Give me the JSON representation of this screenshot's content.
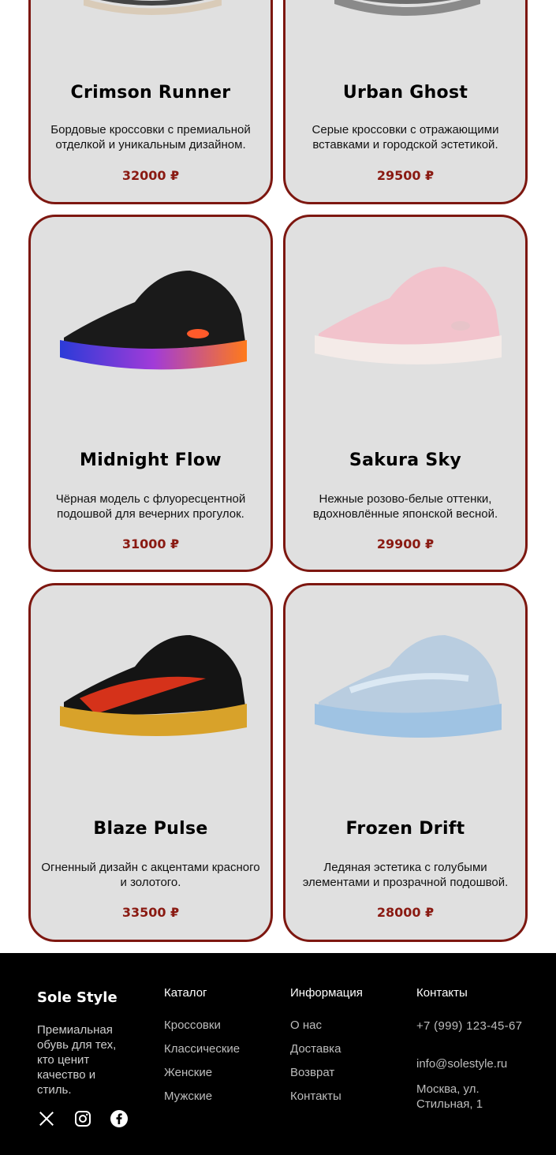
{
  "products": [
    {
      "name": "Crimson Runner",
      "desc": "Бордовые кроссовки с премиальной отделкой и уникальным дизайном.",
      "price": "32000 ₽"
    },
    {
      "name": "Urban Ghost",
      "desc": "Серые кроссовки с отражающими вставками и городской эстетикой.",
      "price": "29500 ₽"
    },
    {
      "name": "Midnight Flow",
      "desc": "Чёрная модель с флуоресцентной подошвой для вечерних прогулок.",
      "price": "31000 ₽"
    },
    {
      "name": "Sakura Sky",
      "desc": "Нежные розово-белые оттенки, вдохновлённые японской весной.",
      "price": "29900 ₽"
    },
    {
      "name": "Blaze Pulse",
      "desc": "Огненный дизайн с акцентами красного и золотого.",
      "price": "33500 ₽"
    },
    {
      "name": "Frozen Drift",
      "desc": "Ледяная эстетика с голубыми элементами и прозрачной подошвой.",
      "price": "28000 ₽"
    }
  ],
  "footer": {
    "brand": "Sole Style",
    "tagline": "Премиальная обувь для тех, кто ценит качество и стиль.",
    "catalog": {
      "title": "Каталог",
      "items": [
        "Кроссовки",
        "Классические",
        "Женские",
        "Мужские"
      ]
    },
    "info": {
      "title": "Информация",
      "items": [
        "О нас",
        "Доставка",
        "Возврат",
        "Контакты"
      ]
    },
    "contacts": {
      "title": "Контакты",
      "phone": "+7 (999) 123-45-67",
      "email": "info@solestyle.ru",
      "address": "Москва, ул. Стильная, 1"
    },
    "socials": [
      "x-icon",
      "instagram-icon",
      "facebook-icon"
    ]
  },
  "colors": {
    "accent": "#7d1710",
    "price": "#8a1a12",
    "card_bg": "#e0e0e0",
    "footer_bg": "#000000"
  }
}
